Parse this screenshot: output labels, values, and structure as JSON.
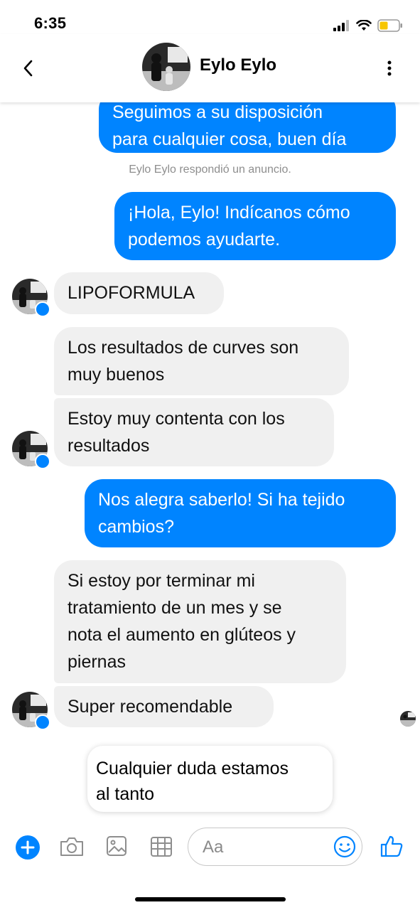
{
  "status_bar": {
    "time": "6:35"
  },
  "header": {
    "contact_name": "Eylo Eylo"
  },
  "system_note": "Eylo Eylo respondió un anuncio.",
  "messages": {
    "m0": [
      "Seguimos a su disposición",
      "para cualquier cosa, buen día"
    ],
    "m1": [
      "¡Hola, Eylo! Indícanos cómo",
      "podemos ayudarte."
    ],
    "m2": [
      "LIPOFORMULA"
    ],
    "m3": [
      "Los resultados de curves son",
      "muy buenos"
    ],
    "m4": [
      "Estoy muy contenta con los",
      "resultados"
    ],
    "m5": [
      "Nos alegra saberlo! Si ha tejido",
      "cambios?"
    ],
    "m6": [
      "Si estoy por terminar mi",
      "tratamiento de un mes y se",
      "nota el aumento en glúteos y",
      "piernas"
    ],
    "m7": [
      "Super recomendable"
    ]
  },
  "suggestion_card": [
    "Cualquier duda estamos",
    "al tanto"
  ],
  "composer": {
    "placeholder": "Aa"
  },
  "colors": {
    "accent": "#0084ff",
    "incoming_bubble": "#f0f0f0"
  },
  "icons": [
    "back-chevron-icon",
    "more-vertical-icon",
    "plus-icon",
    "camera-icon",
    "image-icon",
    "sticker-grid-icon",
    "emoji-icon",
    "thumbs-up-icon"
  ]
}
